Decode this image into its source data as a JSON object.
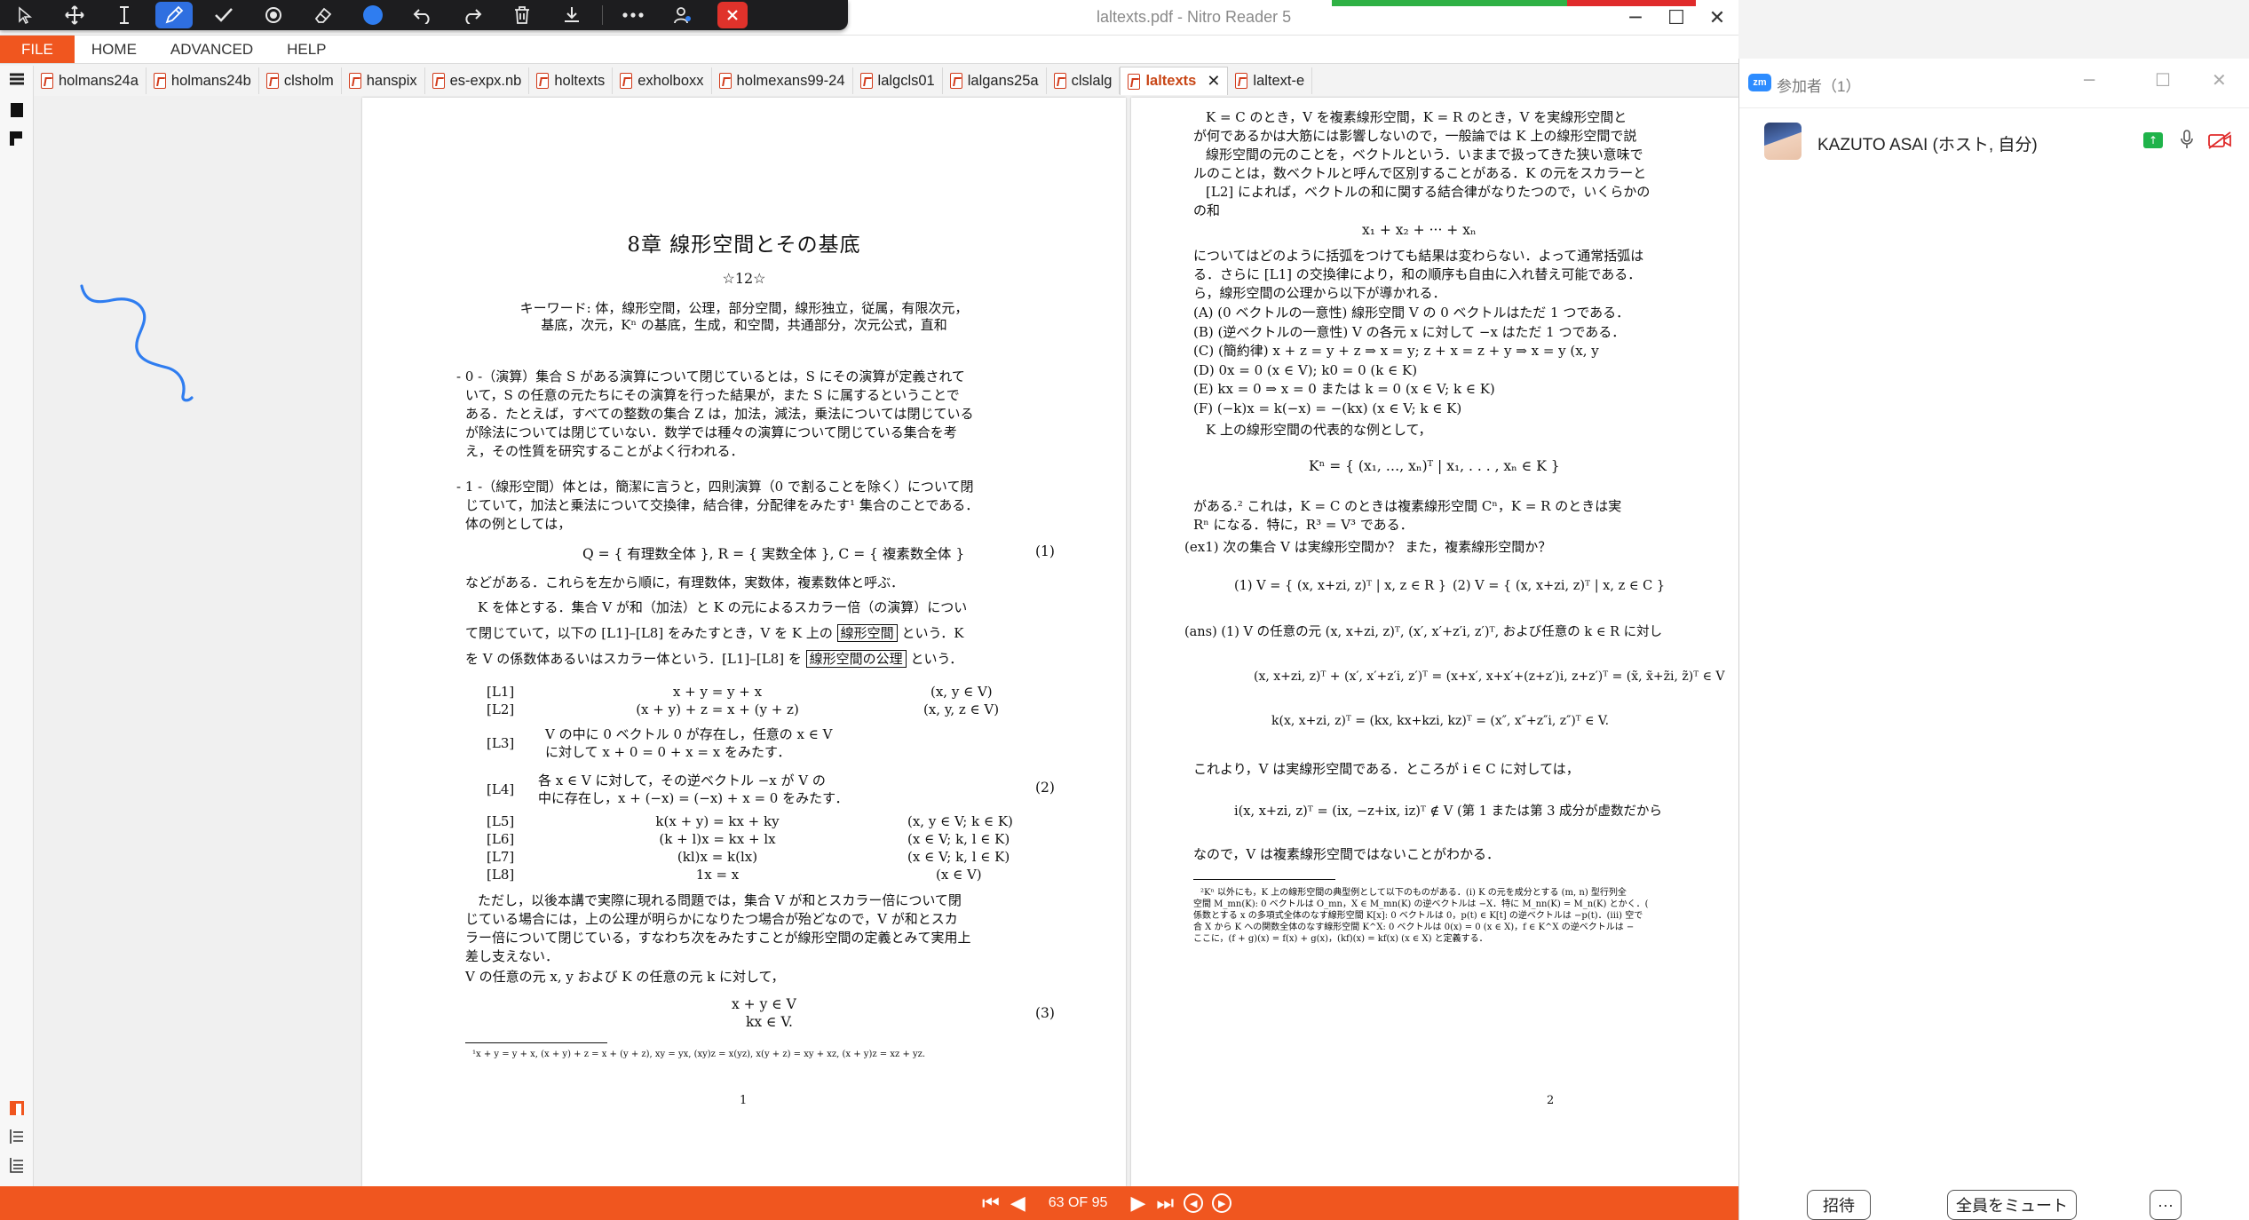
{
  "window": {
    "title": "laltexts.pdf - Nitro Reader 5",
    "minimize_glyph": "─",
    "maximize_glyph": "☐",
    "close_glyph": "✕"
  },
  "annotation_toolbar": {
    "tools": [
      "cursor-icon",
      "move-icon",
      "text-cursor-icon",
      "pen-icon",
      "check-icon",
      "spotlight-icon",
      "eraser-icon",
      "color-dot",
      "undo-icon",
      "redo-icon",
      "trash-icon",
      "save-icon",
      "more-icon",
      "people-icon",
      "close-icon"
    ],
    "active_tool": "pen-icon",
    "color": "#2f7df0"
  },
  "ribbon": {
    "file": "FILE",
    "home": "HOME",
    "advanced": "ADVANCED",
    "help": "HELP"
  },
  "tabs": [
    {
      "label": "holmans24a",
      "active": false
    },
    {
      "label": "holmans24b",
      "active": false
    },
    {
      "label": "clsholm",
      "active": false
    },
    {
      "label": "hanspix",
      "active": false
    },
    {
      "label": "es-expx.nb",
      "active": false
    },
    {
      "label": "holtexts",
      "active": false
    },
    {
      "label": "exholboxx",
      "active": false
    },
    {
      "label": "holmexans99-24",
      "active": false
    },
    {
      "label": "lalgcls01",
      "active": false
    },
    {
      "label": "lalgans25a",
      "active": false
    },
    {
      "label": "clslalg",
      "active": false
    },
    {
      "label": "laltexts",
      "active": true
    },
    {
      "label": "laltext-e",
      "active": false
    }
  ],
  "page1": {
    "chapter_title": "8章 線形空間とその基底",
    "star": "☆12☆",
    "keywords_1": "キーワード: 体，線形空間，公理，部分空間，線形独立，従属，有限次元，",
    "keywords_2": "基底，次元，Kⁿ の基底，生成，和空間，共通部分，次元公式，直和",
    "s0_1": "- 0 -（演算）集合 S がある演算について閉じているとは，S にその演算が定義されて",
    "s0_2": "いて，S の任意の元たちにその演算を行った結果が，また S に属するということで",
    "s0_3": "ある．たとえば，すべての整数の集合 Z は，加法，減法，乗法については閉じている",
    "s0_4": "が除法については閉じていない．数学では種々の演算について閉じている集合を考",
    "s0_5": "え，その性質を研究することがよく行われる．",
    "s1_1": "- 1 -（線形空間）体とは，簡潔に言うと，四則演算（0 で割ることを除く）について閉",
    "s1_2": "じていて，加法と乗法について交換律，結合律，分配律をみたす¹ 集合のことである．",
    "s1_3": "体の例としては，",
    "eq1": "Q = { 有理数全体 },  R = { 実数全体 },  C = { 複素数全体 }",
    "eq1_no": "(1)",
    "p_after_eq1": "などがある．これらを左から順に，有理数体，実数体，複素数体と呼ぶ．",
    "p_k_1a": "K を体とする．集合 V が和（加法）と K の元によるスカラー倍（の演算）につい",
    "p_k_2a": "て閉じていて，以下の [L1]–[L8] をみたすとき，V を K 上の",
    "p_k_2box": "線形空間",
    "p_k_2b": "という．K",
    "p_k_3a": "を V の係数体あるいはスカラー体という．[L1]–[L8] を",
    "p_k_3box": "線形空間の公理",
    "p_k_3b": "という．",
    "axioms": [
      {
        "tag": "[L1]",
        "body": "x + y = y + x",
        "cond": "(x, y ∈ V)"
      },
      {
        "tag": "[L2]",
        "body": "(x + y) + z = x + (y + z)",
        "cond": "(x, y, z ∈ V)"
      },
      {
        "tag": "[L3]",
        "body": "V の中に 0 ベクトル 0 が存在し，任意の x ∈ V",
        "body2": "に対して x + 0 = 0 + x = x をみたす．",
        "cond": ""
      },
      {
        "tag": "[L4]",
        "body": "各 x ∈ V に対して，その逆ベクトル −x が V の",
        "body2": "中に存在し，x + (−x) = (−x) + x = 0 をみたす．",
        "cond": ""
      },
      {
        "tag": "[L5]",
        "body": "k(x + y) = kx + ky",
        "cond": "(x, y ∈ V;  k ∈ K)"
      },
      {
        "tag": "[L6]",
        "body": "(k + l)x = kx + lx",
        "cond": "(x ∈ V;  k, l ∈ K)"
      },
      {
        "tag": "[L7]",
        "body": "(kl)x = k(lx)",
        "cond": "(x ∈ V;  k, l ∈ K)"
      },
      {
        "tag": "[L8]",
        "body": "1x = x",
        "cond": "(x ∈ V)"
      }
    ],
    "eq2_no": "(2)",
    "p_tad_1": "ただし，以後本講で実際に現れる問題では，集合 V が和とスカラー倍について閉",
    "p_tad_2": "じている場合には，上の公理が明らかになりたつ場合が殆どなので，V が和とスカ",
    "p_tad_3": "ラー倍について閉じている，すなわち次をみたすことが線形空間の定義とみて実用上",
    "p_tad_4": "差し支えない．",
    "p_any": "V の任意の元 x, y および K の任意の元 k に対して，",
    "eq3_a": "x + y   ∈ V",
    "eq3_b": "kx   ∈ V.",
    "eq3_no": "(3)",
    "footnote": "¹x + y = y + x, (x + y) + z = x + (y + z), xy = yx, (xy)z = x(yz), x(y + z) = xy + xz, (x + y)z = xz + yz.",
    "page_number": "1"
  },
  "page2": {
    "l1": "K = C のとき，V を複素線形空間，K = R のとき，V を実線形空間と",
    "l2": "が何であるかは大筋には影響しないので，一般論では K 上の線形空間で説",
    "l3": "線形空間の元のことを，ベクトルという．いままで扱ってきた狭い意味で",
    "l4": "ルのことは，数ベクトルと呼んで区別することがある．K の元をスカラーと",
    "l5": "[L2] によれば，ベクトルの和に関する結合律がなりたつので，いくらかの",
    "l6": "の和",
    "eq_sum": "x₁ + x₂ + ··· + xₙ",
    "l7": "についてはどのように括弧をつけても結果は変わらない．よって通常括弧は",
    "l8": "る．さらに [L1] の交換律により，和の順序も自由に入れ替え可能である．",
    "l9": "ら，線形空間の公理から以下が導かれる．",
    "props": [
      "(A)  (0 ベクトルの一意性)   線形空間 V の 0 ベクトルはただ 1 つである．",
      "(B)  (逆ベクトルの一意性)   V の各元 x に対して −x はただ 1 つである．",
      "(C)  (簡約律)    x + z = y + z  ⇒  x = y;    z + x = z + y  ⇒  x = y      (x, y",
      "(D)  0x = 0    (x ∈ V);        k0 = 0    (k ∈ K)",
      "(E)  kx = 0  ⇒  x = 0 または k = 0          (x ∈ V;  k ∈ K)",
      "(F)  (−k)x = k(−x) = −(kx)          (x ∈ V;  k ∈ K)"
    ],
    "l10": "K 上の線形空間の代表的な例として，",
    "eq_kn": "Kⁿ = { (x₁, …, xₙ)ᵀ  |  x₁, . . . , xₙ ∈ K }",
    "l11": "がある.²  これは，K = C のときは複素線形空間 Cⁿ，K = R のときは実",
    "l12": "Rⁿ になる．特に，R³ = V³ である．",
    "ex1": "(ex1)  次の集合 V は実線形空間か？ また，複素線形空間か？",
    "ex1_1": "(1)  V = { (x, x+zi, z)ᵀ  |  x, z ∈ R }",
    "ex1_2": "(2)  V = { (x, x+zi, z)ᵀ  |  x, z ∈ C }",
    "ans": "(ans)  (1)  V の任意の元  (x, x+zi, z)ᵀ,  (x′, x′+z′i, z′)ᵀ,  および任意の k ∈ R に対し",
    "eq_add": "(x, x+zi, z)ᵀ + (x′, x′+z′i, z′)ᵀ = (x+x′, x+x′+(z+z′)i, z+z′)ᵀ = (x̃, x̃+z̃i, z̃)ᵀ ∈ V",
    "eq_mul": "k(x, x+zi, z)ᵀ = (kx, kx+kzi, kz)ᵀ = (x″, x″+z″i, z″)ᵀ ∈ V.",
    "l13": "これより，V は実線形空間である．ところが i ∈ C に対しては，",
    "eq_i": "i(x, x+zi, z)ᵀ = (ix, −z+ix, iz)ᵀ ∉ V        (第 1 または第 3 成分が虚数だから",
    "l14": "なので，V は複素線形空間ではないことがわかる．",
    "fn_1": "²Kⁿ 以外にも，K 上の線形空間の典型例として以下のものがある．(i) K の元を成分とする (m, n) 型行列全",
    "fn_2": "空間 M_mn(K): 0 ベクトルは O_mn，X ∈ M_mn(K) の逆ベクトルは −X．特に M_nn(K) = M_n(K) とかく．(",
    "fn_3": "係数とする x の多項式全体のなす線形空間 K[x]: 0 ベクトルは 0，p(t) ∈ K[t] の逆ベクトルは −p(t)．(iii) 空で",
    "fn_4": "合 X から K への関数全体のなす線形空間 K^X: 0 ベクトルは 0(x) = 0 (x ∈ X)，f ∈ K^X の逆ベクトルは −",
    "fn_5": "ここに，(f + g)(x) = f(x) + g(x)，(kf)(x) = kf(x) (x ∈ X) と定義する．",
    "page_number": "2"
  },
  "zoom": {
    "logo": "zm",
    "title": "参加者（1）",
    "participant_name": "KAZUTO ASAI (ホスト, 自分)",
    "invite": "招待",
    "mute_all": "全員をミュート",
    "more": "···"
  },
  "status": {
    "page_indicator": "63 OF 95"
  },
  "colors": {
    "accent": "#f0561f",
    "active_tab_text": "#c84616",
    "annotation_stroke": "#2f7df0",
    "zoom_blue": "#2d8cff"
  }
}
